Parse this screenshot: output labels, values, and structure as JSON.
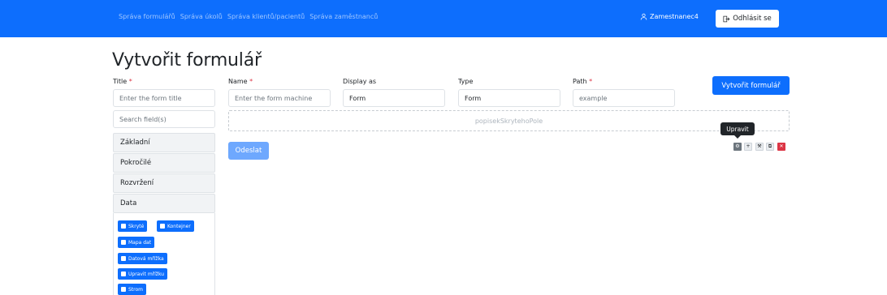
{
  "nav": {
    "links": [
      "Správa formulářů",
      "Správa úkolů",
      "Správa klientů/pacientů",
      "Správa zaměstnanců"
    ],
    "user": "Zamestnanec4",
    "logout": "Odhlásit se"
  },
  "page": {
    "title": "Vytvořit formulář"
  },
  "form": {
    "title_label": "Title",
    "title_placeholder": "Enter the form title",
    "search_placeholder": "Search field(s)",
    "name_label": "Name",
    "name_placeholder": "Enter the form machine",
    "display_label": "Display as",
    "display_value": "Form",
    "type_label": "Type",
    "type_value": "Form",
    "path_label": "Path",
    "path_placeholder": "example",
    "required_mark": "*",
    "create_button": "Vytvořit formulář"
  },
  "sidebar": {
    "groups": [
      "Základní",
      "Pokročilé",
      "Rozvržení",
      "Data"
    ],
    "data_components": [
      "Skryté",
      "Kontejner",
      "Mapa dat",
      "Datová mřížka",
      "Upravit mřížku",
      "Strom"
    ]
  },
  "builder": {
    "dropzone_text": "popisekSkrytehoPole",
    "submit_button": "Odeslat",
    "tooltip": "Upravit",
    "tool_icons": [
      "gear-icon",
      "move-icon",
      "wrench-icon",
      "copy-icon",
      "remove-icon"
    ]
  },
  "colors": {
    "primary": "#0d6efd",
    "danger": "#dc3545",
    "submit_disabled": "#6ea8fe"
  }
}
